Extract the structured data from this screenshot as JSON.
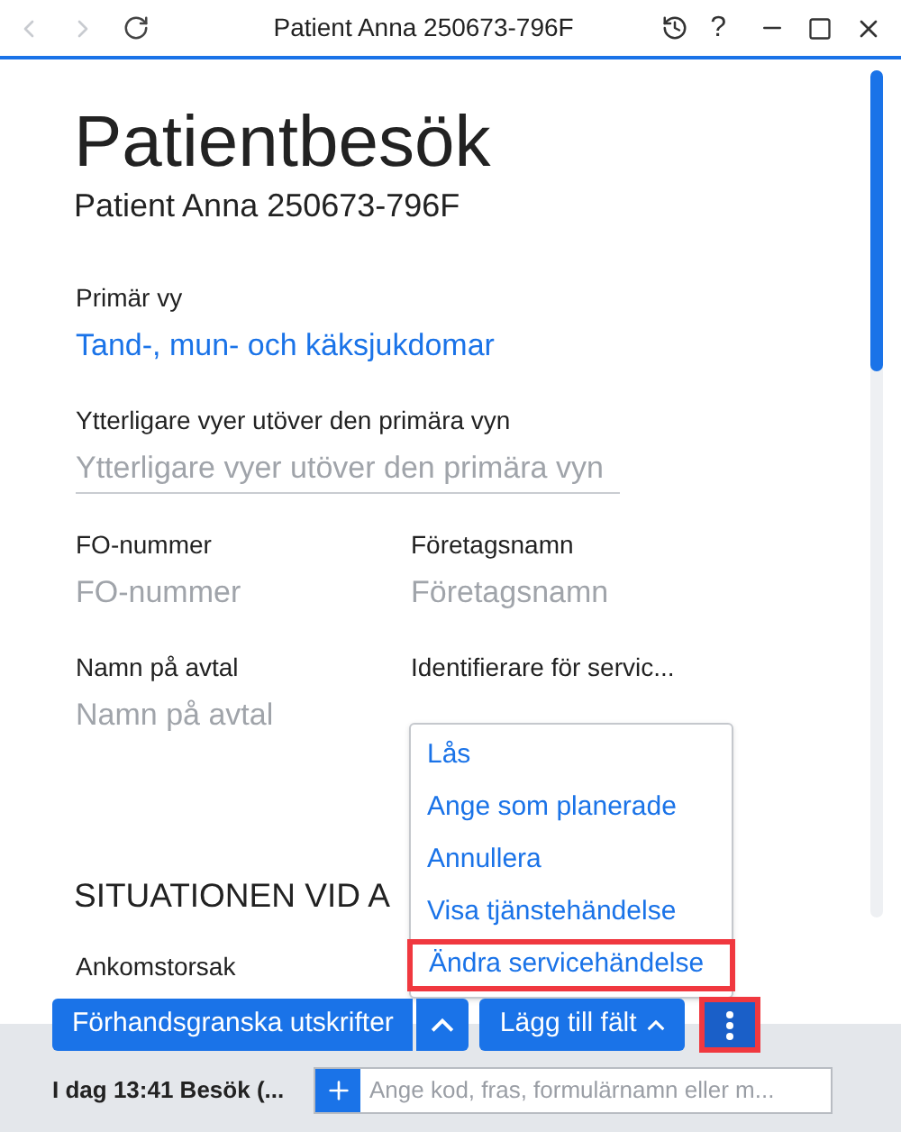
{
  "window": {
    "title": "Patient Anna 250673-796F",
    "help": "?"
  },
  "page": {
    "title": "Patientbesök",
    "subtitle": "Patient Anna 250673-796F"
  },
  "fields": [
    {
      "label": "Primär vy",
      "value": "Tand-, mun- och käksjukdomar"
    },
    {
      "label": "Ytterligare vyer utöver den primära vyn",
      "placeholder": "Ytterligare vyer utöver den primära vyn"
    }
  ],
  "field_pairs": [
    [
      {
        "label": "FO-nummer",
        "placeholder": "FO-nummer"
      },
      {
        "label": "Företagsnamn",
        "placeholder": "Företagsnamn"
      }
    ],
    [
      {
        "label": "Namn på avtal",
        "placeholder": "Namn på avtal"
      },
      {
        "label": "Identifierare för servic..."
      }
    ]
  ],
  "section": {
    "title": "SITUATIONEN VID A",
    "field_label": "Ankomstorsak"
  },
  "menu": [
    {
      "label": "Lås",
      "highlighted": false
    },
    {
      "label": "Ange som planerade",
      "highlighted": false
    },
    {
      "label": "Annullera",
      "highlighted": false
    },
    {
      "label": "Visa tjänstehändelse",
      "highlighted": false
    },
    {
      "label": "Ändra servicehändelse",
      "highlighted": true
    }
  ],
  "actions": {
    "preview": "Förhandsgranska utskrifter",
    "add_field": "Lägg till fält",
    "more_highlighted": true
  },
  "status_bar": {
    "visit": "I dag 13:41 Besök (...",
    "search_placeholder": "Ange kod, fras, formulärnamn eller m..."
  }
}
